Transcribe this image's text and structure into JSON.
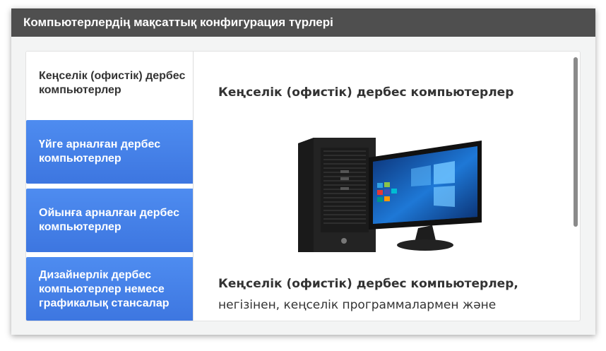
{
  "header": {
    "title": "Компьютерлердің мақсаттық конфигурация түрлері"
  },
  "tabs": [
    {
      "label": "Кеңселік (офистік) дербес компьютерлер",
      "active": true
    },
    {
      "label": "Үйге арналған дербес компьютерлер",
      "active": false
    },
    {
      "label": "Ойынға арналған дербес компьютерлер",
      "active": false
    },
    {
      "label": "Дизайнерлік дербес компьютерлер немесе графикалық стансалар",
      "active": false
    }
  ],
  "content": {
    "title": "Кеңселік (офистік) дербес компьютерлер",
    "image_alt": "office-desktop-computer",
    "text_bold": "Кеңселік (офистік) дербес компьютерлер,",
    "text_rest": " негізінен, кеңселік программалармен және қосымшалармен"
  },
  "colors": {
    "header_bg": "#4f4f4f",
    "tab_blue": "#3f7be4",
    "text": "#333333"
  }
}
